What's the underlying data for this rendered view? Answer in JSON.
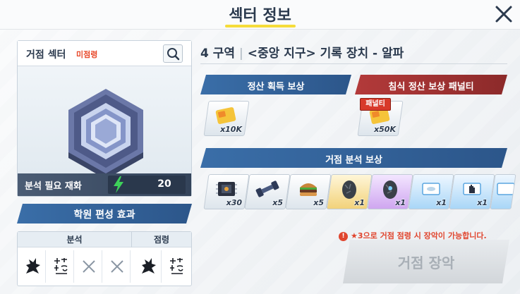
{
  "header": {
    "title": "섹터 정보",
    "accent_color": "#f5dc3a"
  },
  "base": {
    "label": "거점 섹터",
    "status": "미점령",
    "cost_label": "분석 필요 재화",
    "cost_value": "20"
  },
  "academy": {
    "title": "학원 편성 효과",
    "groups": [
      {
        "label": "분석"
      },
      {
        "label": "점령"
      }
    ]
  },
  "zone": {
    "number": "4 구역",
    "name": "<중앙 지구> 기록 장치 - 알파"
  },
  "rewards": {
    "settle_title": "정산 획득 보상",
    "penalty_title": "침식 정산 보상 패널티",
    "settle_items": [
      {
        "icon": "credit-card-icon",
        "count": "x10K"
      }
    ],
    "penalty_badge": "패널티",
    "penalty_items": [
      {
        "icon": "credit-card-icon",
        "count": "x50K"
      }
    ],
    "analysis_title": "거점 분석 보상",
    "analysis_items": [
      {
        "icon": "circuit-board-icon",
        "count": "x30"
      },
      {
        "icon": "dumbbell-part-icon",
        "count": "x5"
      },
      {
        "icon": "burger-icon",
        "count": "x5"
      },
      {
        "icon": "stone-egg-icon",
        "count": "x1"
      },
      {
        "icon": "stone-egg-purple-icon",
        "count": "x1"
      },
      {
        "icon": "blue-ticket-icon",
        "count": "x1"
      },
      {
        "icon": "blue-ticket-glove-icon",
        "count": "x1"
      },
      {
        "icon": "blue-ticket-icon",
        "count": ""
      }
    ]
  },
  "footer": {
    "warning_mark": "!",
    "warning": "★3으로 거점 점령 시 장악이 가능합니다.",
    "occupy_label": "거점 장악"
  }
}
